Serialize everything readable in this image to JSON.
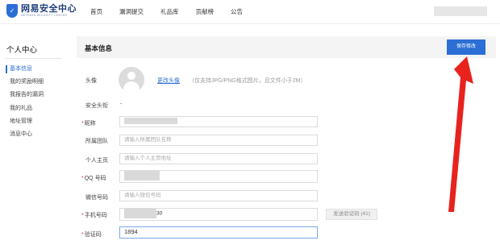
{
  "header": {
    "logo_title": "网易安全中心",
    "logo_subtitle": "NETEASE SECURITY CENTER",
    "nav": [
      "首页",
      "漏洞提交",
      "礼品库",
      "贡献榜",
      "公告"
    ]
  },
  "sidebar": {
    "title": "个人中心",
    "items": [
      "基本信息",
      "我的奖励明细",
      "我报告的漏洞",
      "我的礼品",
      "地址管理",
      "消息中心"
    ]
  },
  "card": {
    "title": "基本信息",
    "save_label": "保存修改"
  },
  "form": {
    "avatar_label": "头像",
    "avatar_link": "更改头像",
    "avatar_hint": "（仅支持JPG/PNG格式图片，且文件小于2M）",
    "security_avatar_label": "安全头衔",
    "security_avatar_value": "-",
    "nickname_label": "昵称",
    "team_label": "所属团队",
    "team_placeholder": "请输入所属团队名称",
    "homepage_label": "个人主页",
    "homepage_placeholder": "请输入个人主页地址",
    "qq_label": "QQ 号码",
    "wechat_label": "微信号码",
    "wechat_placeholder": "请输入微信号码",
    "phone_label": "手机号码",
    "phone_value_suffix": "30",
    "sms_button": "发送验证码 (41)",
    "code_label": "验证码",
    "code_value": "1894",
    "required_mark": "*"
  },
  "colors": {
    "accent": "#2b6fd6",
    "annotation_arrow": "#e8231e"
  }
}
